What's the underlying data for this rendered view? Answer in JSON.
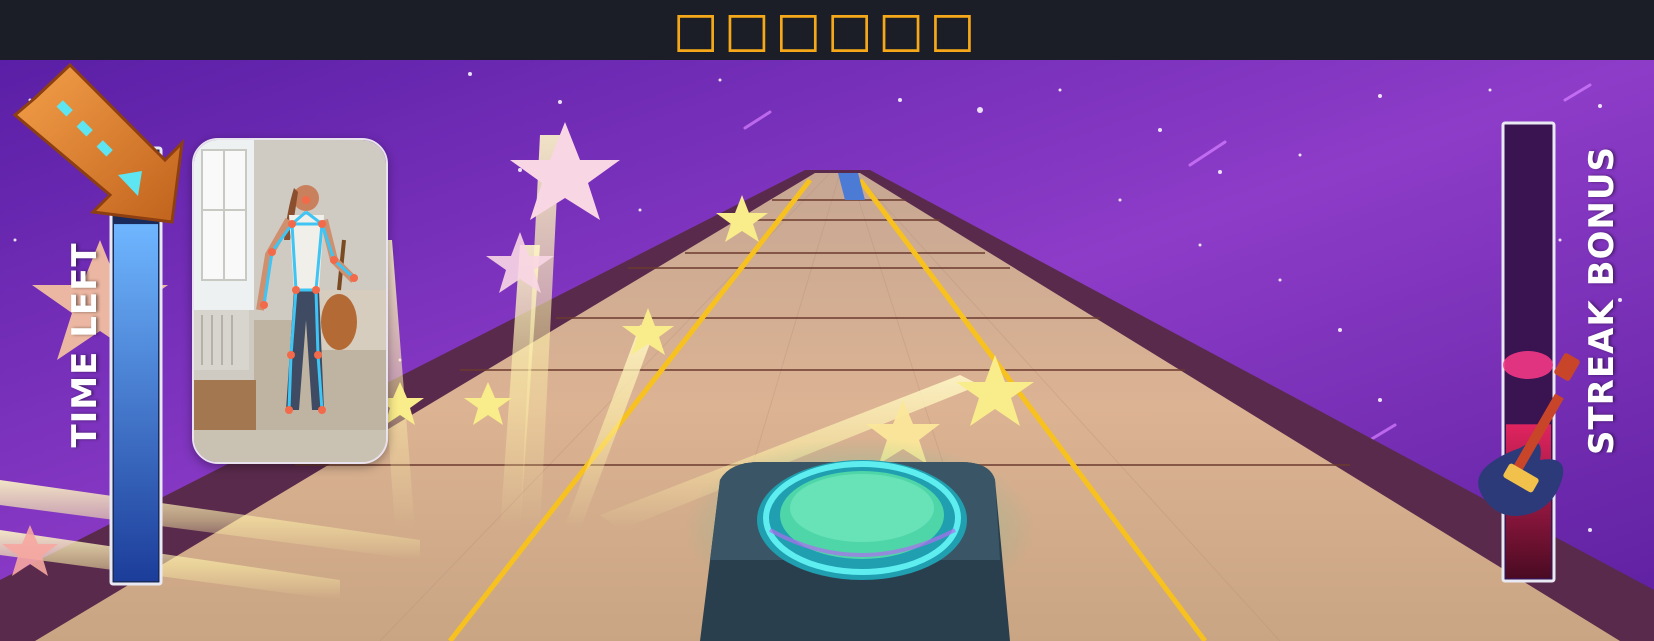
{
  "header": {
    "title": "□□□□□□"
  },
  "hud": {
    "time_left_label": "TIME LEFT",
    "time_left_fill": 0.83,
    "streak_bonus_label": "STREAK BONUS",
    "streak_bonus_fill": 0.34
  },
  "camera_feed": {
    "label": ""
  },
  "icons": {
    "arrow": "down-right-arrow-icon",
    "guitar": "electric-guitar-icon",
    "hit_pad": "hit-button-icon",
    "star": "star-icon"
  },
  "colors": {
    "title": "#f4a81a",
    "header_bg": "#1b1e26",
    "sky": "#6d23b8",
    "lane_line": "#f7c21f",
    "time_fill": "#3a7cf0",
    "streak_fill": "#c3164a",
    "pad": "#4fd6a8"
  }
}
